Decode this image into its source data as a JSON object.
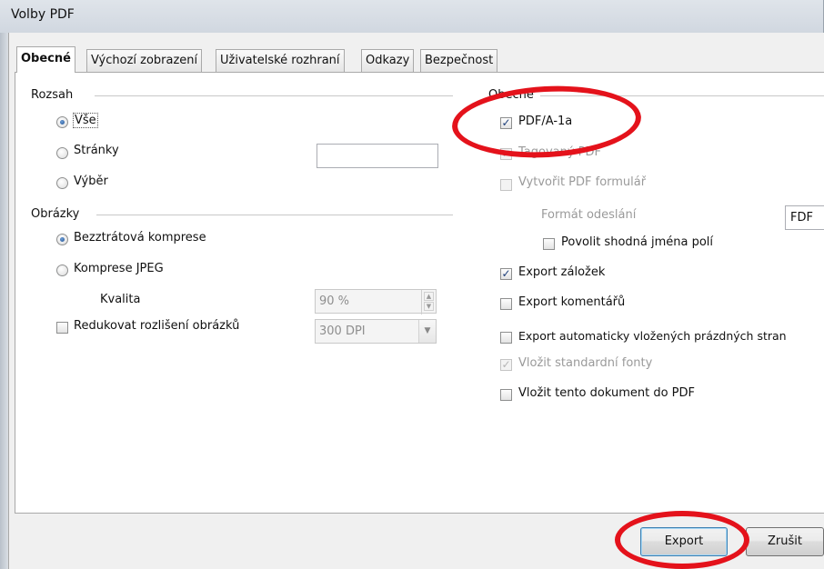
{
  "window": {
    "title": "Volby PDF"
  },
  "tabs": [
    {
      "label": "Obecné"
    },
    {
      "label": "Výchozí zobrazení"
    },
    {
      "label": "Uživatelské rozhraní"
    },
    {
      "label": "Odkazy"
    },
    {
      "label": "Bezpečnost"
    }
  ],
  "range": {
    "section_label": "Rozsah",
    "all_label": "Vše",
    "pages_label": "Stránky",
    "pages_value": "",
    "selection_label": "Výběr",
    "selected": "Vše"
  },
  "images": {
    "section_label": "Obrázky",
    "lossless_label": "Bezztrátová komprese",
    "jpeg_label": "Komprese JPEG",
    "quality_label": "Kvalita",
    "quality_value": "90 %",
    "reduce_label": "Redukovat rozlišení obrázků",
    "reduce_checked": false,
    "resolution_value": "300 DPI",
    "selected": "Bezztrátová komprese"
  },
  "general": {
    "section_label": "Obecné",
    "pdfa_label": "PDF/A-1a",
    "pdfa_checked": true,
    "tagged_label": "Tagovaný PDF",
    "tagged_checked": true,
    "create_form_label": "Vytvořit PDF formulář",
    "create_form_checked": false,
    "submit_format_label": "Formát odeslání",
    "submit_format_value": "FDF",
    "allow_duplicate_label": "Povolit shodná jména polí",
    "allow_duplicate_checked": false,
    "export_bookmarks_label": "Export záložek",
    "export_bookmarks_checked": true,
    "export_comments_label": "Export komentářů",
    "export_comments_checked": false,
    "export_blank_pages_label": "Export automaticky vložených prázdných stran",
    "export_blank_pages_checked": false,
    "embed_fonts_label": "Vložit standardní fonty",
    "embed_fonts_checked": true,
    "embed_doc_label": "Vložit tento dokument do PDF",
    "embed_doc_checked": false
  },
  "buttons": {
    "export_label": "Export",
    "cancel_label": "Zrušit"
  },
  "annotations": {
    "highlight_color": "#e4121b"
  }
}
